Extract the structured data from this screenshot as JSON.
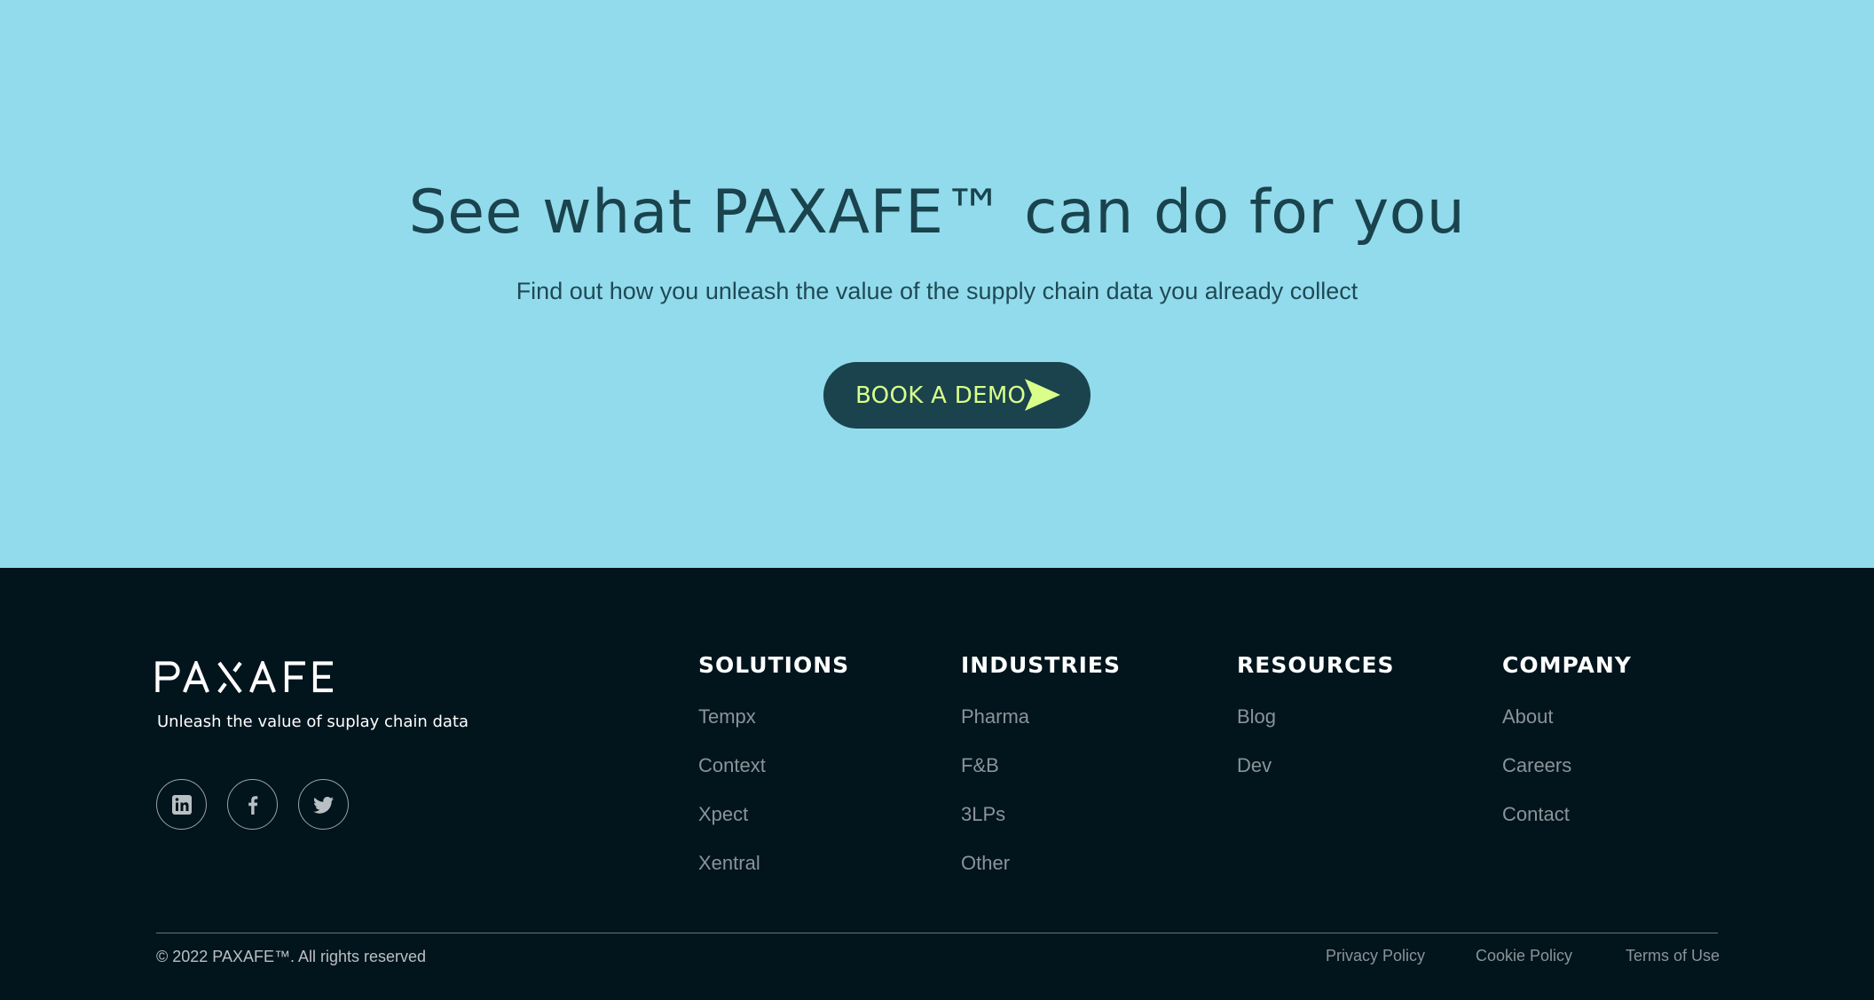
{
  "hero": {
    "title": "See what PAXAFE™ can do for you",
    "subtitle": "Find out how you unleash the value of the supply chain data you already collect",
    "cta_label": "BOOK A DEMO",
    "cta_icon": "arrow-right-icon",
    "background_color": "#92dbec",
    "text_color": "#1a434d",
    "cta_background": "#1a434d",
    "cta_text_color": "#d9ff8a"
  },
  "footer": {
    "logo_text": "PAXAFE",
    "tagline": "Unleash the value of suplay chain data",
    "social": [
      {
        "name": "linkedin",
        "icon": "linkedin-icon"
      },
      {
        "name": "facebook",
        "icon": "facebook-icon"
      },
      {
        "name": "twitter",
        "icon": "twitter-icon"
      }
    ],
    "columns": [
      {
        "heading": "SOLUTIONS",
        "links": [
          "Tempx",
          "Context",
          "Xpect",
          "Xentral"
        ]
      },
      {
        "heading": "INDUSTRIES",
        "links": [
          "Pharma",
          "F&B",
          "3LPs",
          "Other"
        ]
      },
      {
        "heading": "RESOURCES",
        "links": [
          "Blog",
          "Dev"
        ]
      },
      {
        "heading": "COMPANY",
        "links": [
          "About",
          "Careers",
          "Contact"
        ]
      }
    ],
    "copyright": "© 2022 PAXAFE™. All rights reserved",
    "legal_links": [
      "Privacy Policy",
      "Cookie Policy",
      "Terms of Use"
    ],
    "background_color": "#02141c",
    "link_color": "#8a949a"
  }
}
